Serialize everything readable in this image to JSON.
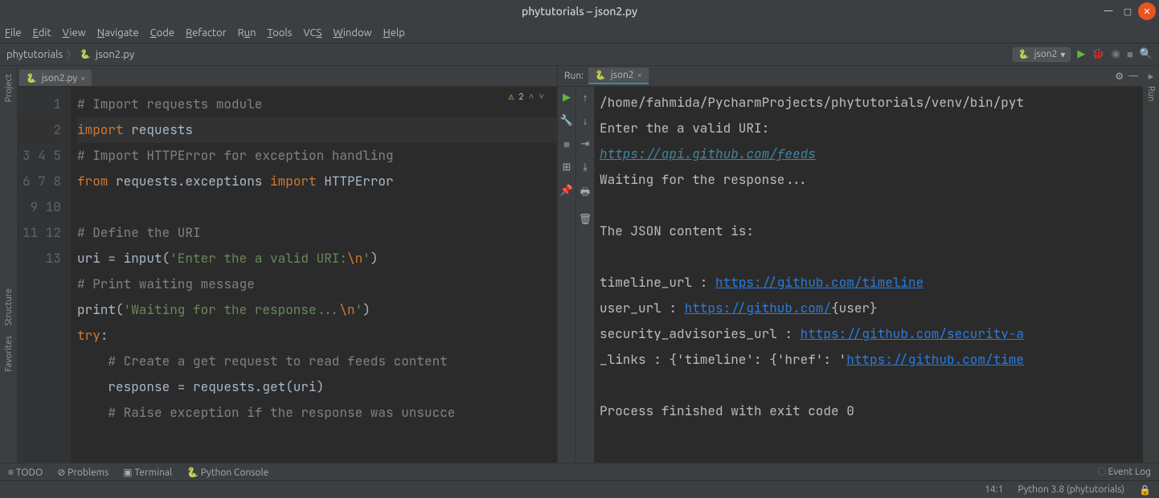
{
  "title": "phytutorials – json2.py",
  "menus": [
    "File",
    "Edit",
    "View",
    "Navigate",
    "Code",
    "Refactor",
    "Run",
    "Tools",
    "VCS",
    "Window",
    "Help"
  ],
  "breadcrumb": {
    "project": "phytutorials",
    "file": "json2.py"
  },
  "run_config": "json2",
  "editor_tab": "json2.py",
  "warn_count": "2",
  "code": {
    "l1": "# Import requests module",
    "l2a": "import",
    "l2b": " requests",
    "l3": "# Import HTTPError for exception handling",
    "l4a": "from",
    "l4b": " requests.exceptions ",
    "l4c": "import",
    "l4d": " HTTPError",
    "l6": "# Define the URI",
    "l7a": "uri = input(",
    "l7b": "'Enter the a valid URI:",
    "l7c": "\\n",
    "l7d": "'",
    "l7e": ")",
    "l8": "# Print waiting message",
    "l9a": "print(",
    "l9b": "'Waiting for the response...",
    "l9c": "\\n",
    "l9d": "'",
    "l9e": ")",
    "l10a": "try",
    "l10b": ":",
    "l11": "    # Create a get request to read feeds content",
    "l12": "    response = requests.get(uri)",
    "l13": "    # Raise exception if the response was unsucce"
  },
  "run_tab": "json2",
  "run_label": "Run:",
  "console": {
    "l1": "/home/fahmida/PycharmProjects/phytutorials/venv/bin/pyt",
    "l2": "Enter the a valid URI:",
    "l3": "https://api.github.com/feeds",
    "l4": "Waiting for the response...",
    "l6": "The JSON content is:",
    "l8a": "timeline_url : ",
    "l8b": "https://github.com/timeline",
    "l9a": "user_url : ",
    "l9b": "https://github.com/",
    "l9c": "{user}",
    "l10a": "security_advisories_url : ",
    "l10b": "https://github.com/security-a",
    "l11a": "_links : {'timeline': {'href': '",
    "l11b": "https://github.com/time",
    "l13": "Process finished with exit code 0"
  },
  "bottom": {
    "todo": "TODO",
    "problems": "Problems",
    "terminal": "Terminal",
    "pyconsole": "Python Console",
    "eventlog": "Event Log"
  },
  "status": {
    "pos": "14:1",
    "python": "Python 3.8 (phytutorials)"
  },
  "sidetabs": {
    "project": "Project",
    "structure": "Structure",
    "favorites": "Favorites",
    "run": "Run"
  }
}
